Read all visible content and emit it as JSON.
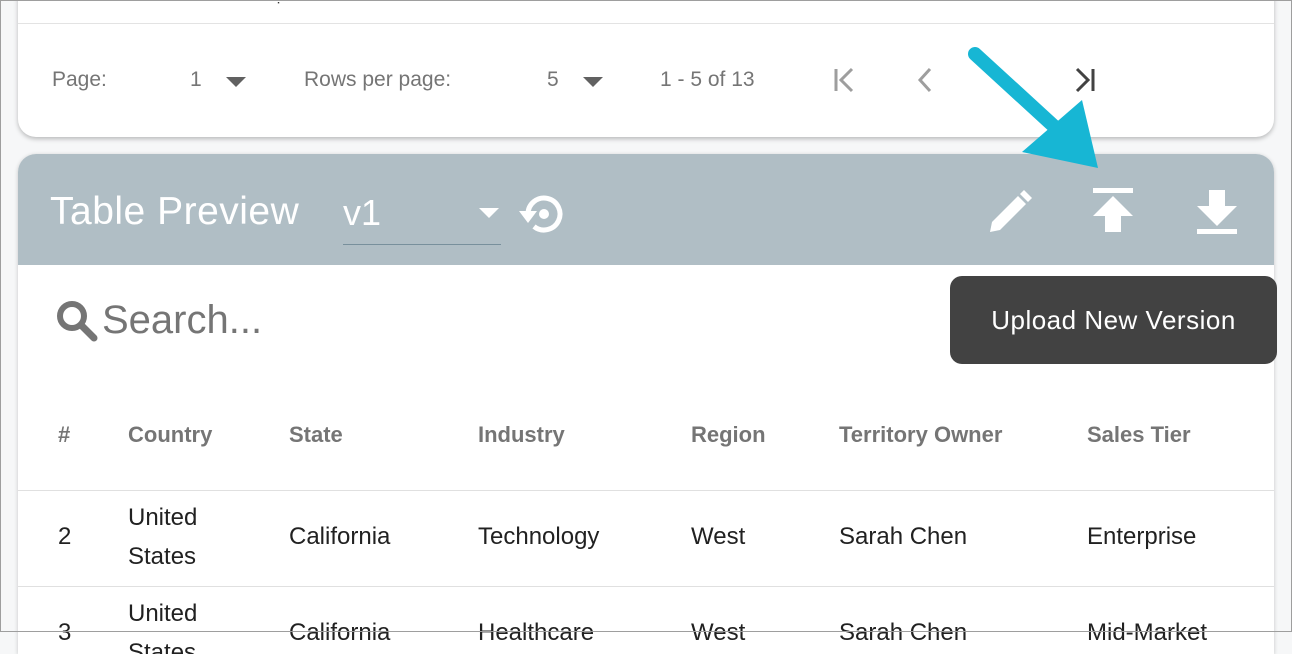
{
  "pagination": {
    "page_label": "Page:",
    "page_value": "1",
    "rows_label": "Rows per page:",
    "rows_value": "5",
    "range": "1 - 5 of 13",
    "clipped_text": "ẹ"
  },
  "preview": {
    "title": "Table Preview",
    "version": "v1",
    "tooltip": "Upload New Version",
    "search_placeholder": "Search..."
  },
  "icons": {
    "first_page": "first-page-icon",
    "prev_page": "chevron-left-icon",
    "last_page": "last-page-icon",
    "restore": "restore-icon",
    "edit": "pencil-icon",
    "upload": "upload-icon",
    "download": "download-icon",
    "search": "search-icon"
  },
  "colors": {
    "header_bg": "#b0bec5",
    "tooltip_bg": "#424242",
    "callout_arrow": "#17b6d4"
  },
  "table": {
    "columns": [
      "#",
      "Country",
      "State",
      "Industry",
      "Region",
      "Territory Owner",
      "Sales Tier"
    ],
    "rows": [
      [
        "2",
        "United States",
        "California",
        "Technology",
        "West",
        "Sarah Chen",
        "Enterprise"
      ],
      [
        "3",
        "United States",
        "California",
        "Healthcare",
        "West",
        "Sarah Chen",
        "Mid-Market"
      ]
    ],
    "row_country_lines": [
      [
        "United",
        "States"
      ],
      [
        "United",
        "States"
      ]
    ]
  }
}
